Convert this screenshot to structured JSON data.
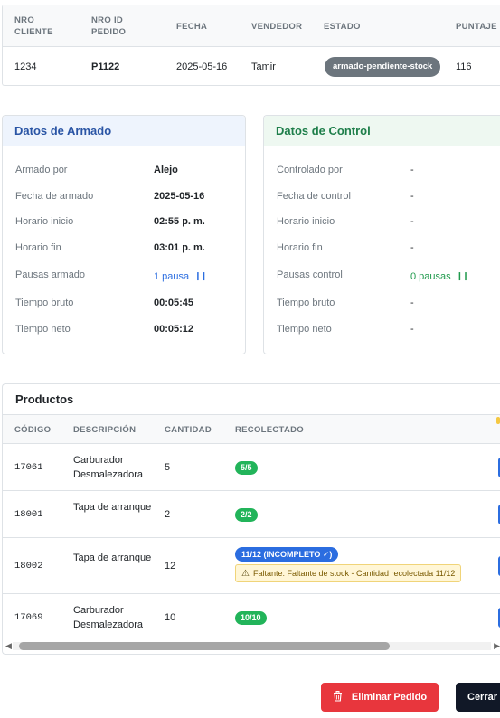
{
  "order_table": {
    "headers": {
      "nro_cliente": [
        "NRO",
        "CLIENTE"
      ],
      "nro_id_pedido": [
        "NRO ID",
        "PEDIDO"
      ],
      "fecha": "FECHA",
      "vendedor": "VENDEDOR",
      "estado": "ESTADO",
      "puntaje": "PUNTAJE"
    },
    "row": {
      "nro_cliente": "1234",
      "nro_id_pedido": "P1122",
      "fecha": "2025-05-16",
      "vendedor": "Tamir",
      "estado": "armado-pendiente-stock",
      "puntaje": "116"
    }
  },
  "armado": {
    "title": "Datos de Armado",
    "rows": [
      {
        "label": "Armado por",
        "value": "Alejo"
      },
      {
        "label": "Fecha de armado",
        "value": "2025-05-16"
      },
      {
        "label": "Horario inicio",
        "value": "02:55 p. m."
      },
      {
        "label": "Horario fin",
        "value": "03:01 p. m."
      },
      {
        "label": "Pausas armado",
        "value": "1 pausa"
      },
      {
        "label": "Tiempo bruto",
        "value": "00:05:45"
      },
      {
        "label": "Tiempo neto",
        "value": "00:05:12"
      }
    ]
  },
  "control": {
    "title": "Datos de Control",
    "rows": [
      {
        "label": "Controlado por",
        "value": "-"
      },
      {
        "label": "Fecha de control",
        "value": "-"
      },
      {
        "label": "Horario inicio",
        "value": "-"
      },
      {
        "label": "Horario fin",
        "value": "-"
      },
      {
        "label": "Pausas control",
        "value": "0 pausas"
      },
      {
        "label": "Tiempo bruto",
        "value": "-"
      },
      {
        "label": "Tiempo neto",
        "value": "-"
      }
    ]
  },
  "productos": {
    "title": "Productos",
    "headers": {
      "codigo": "CÓDIGO",
      "descripcion": "DESCRIPCIÓN",
      "cantidad": "CANTIDAD",
      "recolectado": "RECOLECTADO"
    },
    "rows": [
      {
        "codigo": "17061",
        "descripcion": "Carburador Desmalezadora",
        "cantidad": "5",
        "recolectado": "5/5"
      },
      {
        "codigo": "18001",
        "descripcion": "Tapa de arranque",
        "cantidad": "2",
        "recolectado": "2/2"
      },
      {
        "codigo": "18002",
        "descripcion": "Tapa de arranque",
        "cantidad": "12",
        "recolectado": "11/12 (INCOMPLETO ✓)",
        "warning": "Faltante: Faltante de stock - Cantidad recolectada 11/12"
      },
      {
        "codigo": "17069",
        "descripcion": "Carburador Desmalezadora",
        "cantidad": "10",
        "recolectado": "10/10"
      }
    ]
  },
  "actions": {
    "eliminar": "Eliminar Pedido",
    "cerrar": "Cerrar"
  },
  "colors": {
    "danger": "#e8363d",
    "primary": "#2b6de0",
    "success": "#22b45a",
    "dark": "#111827"
  },
  "icons": {
    "pause": "pause-icon",
    "warning": "warning-icon",
    "trash": "trash-icon"
  }
}
